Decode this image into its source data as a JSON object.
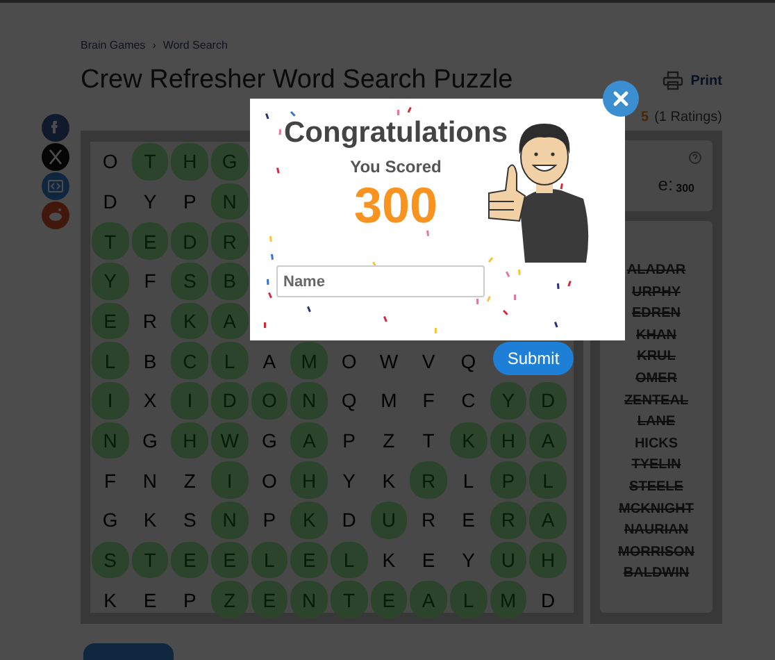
{
  "breadcrumb": {
    "items": [
      {
        "label": "Brain Games"
      },
      {
        "label": "Word Search"
      }
    ],
    "separator": "›"
  },
  "title": "Crew Refresher Word Search Puzzle",
  "print_label": "Print",
  "rating": {
    "value": "5",
    "count": "(1 Ratings)"
  },
  "share_buttons": [
    {
      "kind": "facebook"
    },
    {
      "kind": "x"
    },
    {
      "kind": "embed"
    },
    {
      "kind": "reddit"
    }
  ],
  "grid": {
    "rows": [
      {
        "cells": [
          {
            "letter": "O",
            "found": false
          },
          {
            "letter": "T",
            "found": true
          },
          {
            "letter": "H",
            "found": true
          },
          {
            "letter": "G",
            "found": true
          }
        ]
      },
      {
        "cells": [
          {
            "letter": "D",
            "found": false
          },
          {
            "letter": "Y",
            "found": false
          },
          {
            "letter": "P",
            "found": false
          },
          {
            "letter": "N",
            "found": true
          }
        ]
      },
      {
        "cells": [
          {
            "letter": "T",
            "found": true
          },
          {
            "letter": "E",
            "found": true
          },
          {
            "letter": "D",
            "found": true
          },
          {
            "letter": "R",
            "found": true
          }
        ]
      },
      {
        "cells": [
          {
            "letter": "Y",
            "found": true
          },
          {
            "letter": "F",
            "found": false
          },
          {
            "letter": "S",
            "found": true
          },
          {
            "letter": "B",
            "found": true
          }
        ]
      },
      {
        "cells": [
          {
            "letter": "E",
            "found": true
          },
          {
            "letter": "R",
            "found": false
          },
          {
            "letter": "K",
            "found": true
          },
          {
            "letter": "A",
            "found": true
          }
        ]
      },
      {
        "cells": [
          {
            "letter": "L",
            "found": true
          },
          {
            "letter": "B",
            "found": false
          },
          {
            "letter": "C",
            "found": true
          },
          {
            "letter": "L",
            "found": true
          },
          {
            "letter": "A",
            "found": false
          },
          {
            "letter": "M",
            "found": true
          },
          {
            "letter": "O",
            "found": false
          },
          {
            "letter": "W",
            "found": false
          },
          {
            "letter": "V",
            "found": false
          },
          {
            "letter": "Q",
            "found": false
          }
        ]
      },
      {
        "cells": [
          {
            "letter": "I",
            "found": true
          },
          {
            "letter": "X",
            "found": false
          },
          {
            "letter": "I",
            "found": true
          },
          {
            "letter": "D",
            "found": true
          },
          {
            "letter": "O",
            "found": true
          },
          {
            "letter": "N",
            "found": true
          },
          {
            "letter": "Q",
            "found": false
          },
          {
            "letter": "M",
            "found": false
          },
          {
            "letter": "F",
            "found": false
          },
          {
            "letter": "C",
            "found": false
          },
          {
            "letter": "Y",
            "found": true
          },
          {
            "letter": "D",
            "found": true
          }
        ]
      },
      {
        "cells": [
          {
            "letter": "N",
            "found": true
          },
          {
            "letter": "G",
            "found": false
          },
          {
            "letter": "H",
            "found": true
          },
          {
            "letter": "W",
            "found": true
          },
          {
            "letter": "G",
            "found": false
          },
          {
            "letter": "A",
            "found": true
          },
          {
            "letter": "P",
            "found": false
          },
          {
            "letter": "Z",
            "found": false
          },
          {
            "letter": "T",
            "found": false
          },
          {
            "letter": "K",
            "found": true
          },
          {
            "letter": "H",
            "found": true
          },
          {
            "letter": "A",
            "found": true
          }
        ]
      },
      {
        "cells": [
          {
            "letter": "F",
            "found": false
          },
          {
            "letter": "N",
            "found": false
          },
          {
            "letter": "Z",
            "found": false
          },
          {
            "letter": "I",
            "found": true
          },
          {
            "letter": "O",
            "found": false
          },
          {
            "letter": "H",
            "found": true
          },
          {
            "letter": "Y",
            "found": false
          },
          {
            "letter": "K",
            "found": false
          },
          {
            "letter": "R",
            "found": true
          },
          {
            "letter": "L",
            "found": false
          },
          {
            "letter": "P",
            "found": true
          },
          {
            "letter": "L",
            "found": true
          }
        ]
      },
      {
        "cells": [
          {
            "letter": "G",
            "found": false
          },
          {
            "letter": "K",
            "found": false
          },
          {
            "letter": "S",
            "found": false
          },
          {
            "letter": "N",
            "found": true
          },
          {
            "letter": "P",
            "found": false
          },
          {
            "letter": "K",
            "found": true
          },
          {
            "letter": "D",
            "found": false
          },
          {
            "letter": "U",
            "found": true
          },
          {
            "letter": "R",
            "found": false
          },
          {
            "letter": "E",
            "found": false
          },
          {
            "letter": "R",
            "found": true
          },
          {
            "letter": "A",
            "found": true
          }
        ]
      },
      {
        "cells": [
          {
            "letter": "S",
            "found": true
          },
          {
            "letter": "T",
            "found": true
          },
          {
            "letter": "E",
            "found": true
          },
          {
            "letter": "E",
            "found": true
          },
          {
            "letter": "L",
            "found": true
          },
          {
            "letter": "E",
            "found": true
          },
          {
            "letter": "L",
            "found": true
          },
          {
            "letter": "K",
            "found": false
          },
          {
            "letter": "E",
            "found": false
          },
          {
            "letter": "Y",
            "found": false
          },
          {
            "letter": "U",
            "found": true
          },
          {
            "letter": "H",
            "found": true
          }
        ]
      },
      {
        "cells": [
          {
            "letter": "K",
            "found": false
          },
          {
            "letter": "E",
            "found": false
          },
          {
            "letter": "P",
            "found": false
          },
          {
            "letter": "Z",
            "found": true
          },
          {
            "letter": "E",
            "found": true
          },
          {
            "letter": "N",
            "found": true
          },
          {
            "letter": "T",
            "found": true
          },
          {
            "letter": "E",
            "found": true
          },
          {
            "letter": "A",
            "found": true
          },
          {
            "letter": "L",
            "found": true
          },
          {
            "letter": "M",
            "found": true
          },
          {
            "letter": "D",
            "found": false
          }
        ]
      }
    ]
  },
  "score_card": {
    "label": "e:",
    "value": "300"
  },
  "word_list": [
    {
      "word": "ALADAR",
      "found": true
    },
    {
      "word": "URPHY",
      "found": true
    },
    {
      "word": "EDREN",
      "found": true
    },
    {
      "word": "KHAN",
      "found": true
    },
    {
      "word": "KRUL",
      "found": true
    },
    {
      "word": "OMER",
      "found": true
    },
    {
      "word": "ZENTEAL",
      "found": true
    },
    {
      "word": "LANE",
      "found": true
    },
    {
      "word": "HICKS",
      "found": false
    },
    {
      "word": "TYELIN",
      "found": true
    },
    {
      "word": "STEELE",
      "found": true
    },
    {
      "word": "MCKNIGHT",
      "found": true
    },
    {
      "word": "NAURIAN",
      "found": true
    },
    {
      "word": "MORRISON",
      "found": true
    },
    {
      "word": "BALDWIN",
      "found": true
    }
  ],
  "modal": {
    "title": "Congratulations",
    "subtitle": "You Scored",
    "score": "300",
    "name_placeholder": "Name",
    "submit_label": "Submit"
  }
}
